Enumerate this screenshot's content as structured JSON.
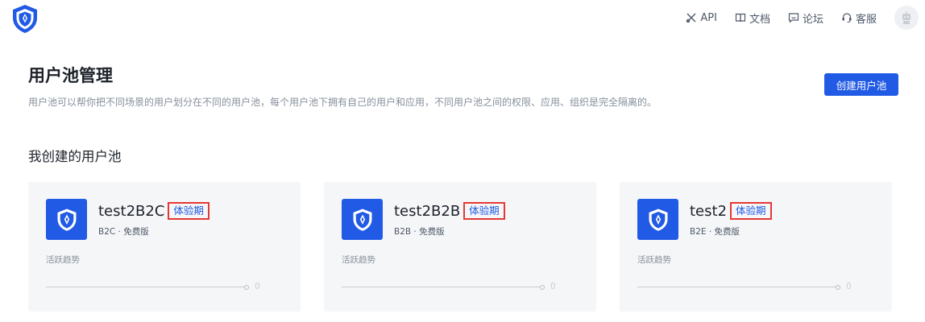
{
  "header": {
    "nav": [
      {
        "label": "API",
        "icon": "api-tools-icon"
      },
      {
        "label": "文档",
        "icon": "book-icon"
      },
      {
        "label": "论坛",
        "icon": "chat-bubble-icon"
      },
      {
        "label": "客服",
        "icon": "headset-icon"
      }
    ],
    "avatar_icon": "robot-avatar-icon"
  },
  "page": {
    "title": "用户池管理",
    "description": "用户池可以帮你把不同场景的用户划分在不同的用户池，每个用户池下拥有自己的用户和应用，不同用户池之间的权限、应用、组织是完全隔离的。",
    "create_button": "创建用户池"
  },
  "section": {
    "title": "我创建的用户池"
  },
  "pools": [
    {
      "name": "test2B2C",
      "badge": "体验期",
      "subtitle": "B2C · 免费版",
      "trend_label": "活跃趋势",
      "trend_value": "0"
    },
    {
      "name": "test2B2B",
      "badge": "体验期",
      "subtitle": "B2B · 免费版",
      "trend_label": "活跃趋势",
      "trend_value": "0"
    },
    {
      "name": "test2",
      "badge": "体验期",
      "subtitle": "B2E · 免费版",
      "trend_label": "活跃趋势",
      "trend_value": "0"
    }
  ],
  "colors": {
    "accent": "#215ae5",
    "badge_border": "#e53935",
    "card_bg": "#f5f6f8"
  }
}
